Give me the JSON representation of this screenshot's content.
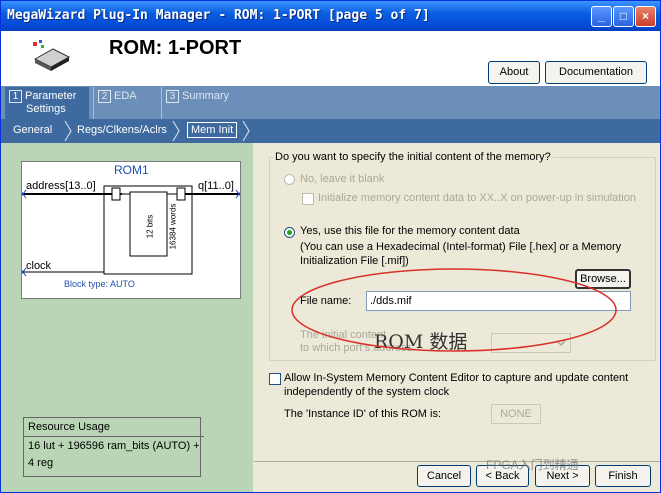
{
  "window": {
    "title": "MegaWizard Plug-In Manager - ROM: 1-PORT [page 5 of 7]",
    "minimize_glyph": "_",
    "maximize_glyph": "□",
    "close_glyph": "×"
  },
  "header": {
    "page_title": "ROM: 1-PORT",
    "about_label": "About",
    "documentation_label": "Documentation"
  },
  "tabs": [
    {
      "num": "1",
      "label_line1": "Parameter",
      "label_line2": "Settings"
    },
    {
      "num": "2",
      "label_line1": "EDA",
      "label_line2": ""
    },
    {
      "num": "3",
      "label_line1": "Summary",
      "label_line2": ""
    }
  ],
  "subtabs": [
    "General",
    "Regs/Clkens/Aclrs",
    "Mem Init"
  ],
  "symbol": {
    "name": "ROM1",
    "address_port": "address[13..0]",
    "q_port": "q[11..0]",
    "clock_port": "clock",
    "block_bits": "12 bits",
    "block_words": "16384 words",
    "block_type": "Block type: AUTO"
  },
  "resource": {
    "heading": "Resource Usage",
    "line1": "16 lut + 196596 ram_bits (AUTO) +",
    "line2": "4 reg"
  },
  "mem_init": {
    "question": "Do you want to specify the initial content of the memory?",
    "option_no": "No, leave it blank",
    "option_no_selected": false,
    "init_xx_label": "Initialize memory content data to XX..X on power-up in simulation",
    "option_yes": "Yes, use this file for the memory content data",
    "option_yes_selected": true,
    "hint_line1": "(You can use a Hexadecimal (Intel-format) File [.hex] or a Memory",
    "hint_line2": "Initialization File [.mif])",
    "browse_label": "Browse...",
    "file_name_label": "File name:",
    "file_name_value": "./dds.mif",
    "initial_content_line1": "The initial content",
    "initial_content_line2": "to which port's address",
    "annotation": "ROM 数据"
  },
  "insystem": {
    "label_line1": "Allow In-System Memory Content Editor to capture and update content",
    "label_line2": "independently of the system clock",
    "checked": false,
    "instance_id_label": "The 'Instance ID' of this ROM is:",
    "instance_id_value": "NONE"
  },
  "footer": {
    "cancel_label": "Cancel",
    "back_label": "< Back",
    "next_label": "Next >",
    "finish_label": "Finish",
    "watermark": "FPGA入门到精通"
  },
  "colors": {
    "title_bar": "#0a5fe0",
    "tab_bar": "#6b8fb8",
    "subtab_bar": "#3e6aa0",
    "left_pane": "#b9d5b5",
    "annotation_ellipse": "#d9302a"
  }
}
